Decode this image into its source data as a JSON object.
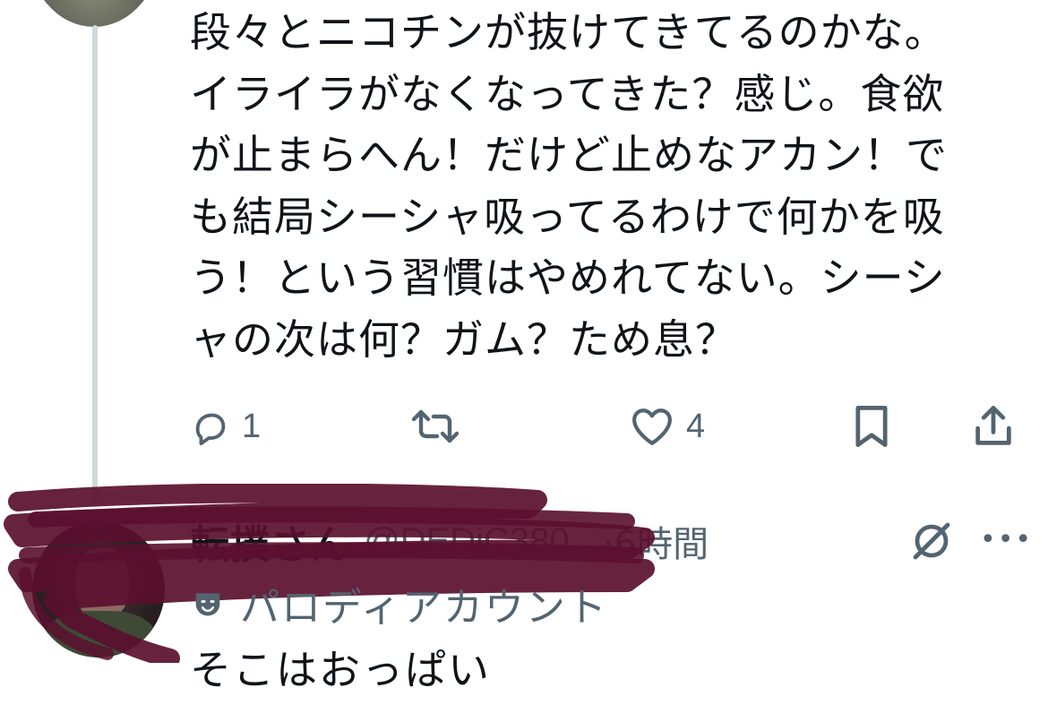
{
  "post": {
    "text": "段々とニコチンが抜けてきてるのかな。\nイライラがなくなってきた？感じ。食欲\nが止まらへん！だけど止めなアカン！で\nも結局シーシャ吸ってるわけで何かを吸\nう！という習慣はやめれてない。シーシ\nャの次は何？ガム？ため息？",
    "actions": {
      "reply_count": "1",
      "retweet_count": "",
      "like_count": "4"
    }
  },
  "reply": {
    "name": "転撲さん",
    "handle": "@DEDiC380...",
    "time": "·6時間",
    "parody_label": "パロディアカウント",
    "text": "そこはおっぱい"
  },
  "colors": {
    "text": "#0f1419",
    "muted": "#536471",
    "thread_line": "#cfd9de",
    "scribble": "#5a0f2e"
  },
  "icons": {
    "reply": "speech-bubble-icon",
    "retweet": "retweet-icon",
    "like": "heart-icon",
    "bookmark": "bookmark-icon",
    "share": "share-icon",
    "grok": "grok-icon",
    "more": "more-icon",
    "parody": "theater-mask-icon"
  }
}
